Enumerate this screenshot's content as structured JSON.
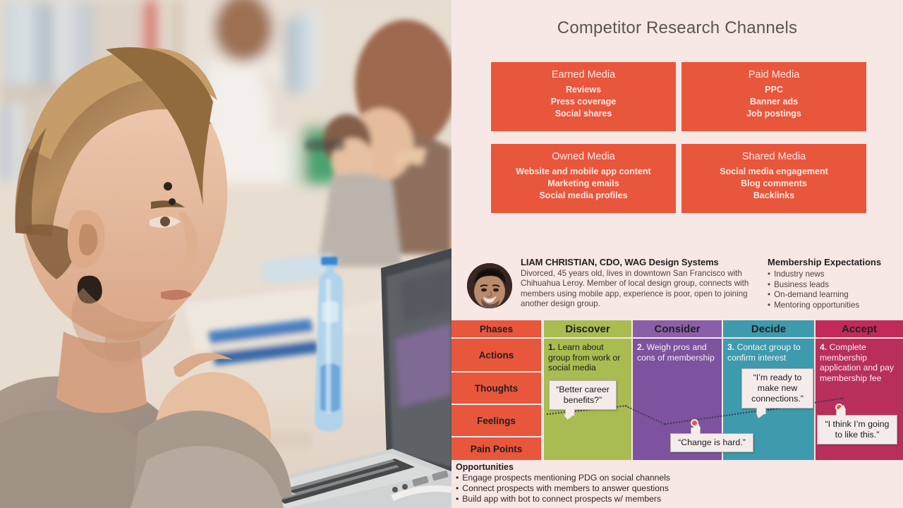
{
  "photo": {
    "alt": "Young man with styled hair studying at a laptop in a library, blurred students and bookshelves behind"
  },
  "slide": {
    "title": "Competitor Research Channels",
    "media_boxes": [
      {
        "title": "Earned Media",
        "items": [
          "Reviews",
          "Press coverage",
          "Social shares"
        ]
      },
      {
        "title": "Paid Media",
        "items": [
          "PPC",
          "Banner ads",
          "Job postings"
        ]
      },
      {
        "title": "Owned Media",
        "items": [
          "Website and mobile app content",
          "Marketing emails",
          "Social media profiles"
        ]
      },
      {
        "title": "Shared Media",
        "items": [
          "Social media engagement",
          "Blog comments",
          "Backlinks"
        ]
      }
    ],
    "persona": {
      "name": "LIAM CHRISTIAN, CDO, WAG Design Systems",
      "description": "Divorced, 45 years old, lives in downtown San Francisco with Chihuahua Leroy. Member of local design group, connects with members using mobile app, experience is poor, open to joining another design group."
    },
    "expectations": {
      "heading": "Membership Expectations",
      "items": [
        "Industry news",
        "Business leads",
        "On-demand learning",
        "Mentoring opportunities"
      ]
    },
    "journey_map": {
      "phase_header": "Phases",
      "row_labels": [
        "Actions",
        "Thoughts",
        "Feelings",
        "Pain Points"
      ],
      "phases": [
        {
          "name": "Discover",
          "color": "#a8bc52",
          "header_color": "#a8bc52",
          "action_num": "1.",
          "action": "Learn about group from work or social media",
          "quote": "“Better career benefits?”"
        },
        {
          "name": "Consider",
          "color": "#7d529e",
          "header_color": "#8a5fa8",
          "action_num": "2.",
          "action": "Weigh pros and cons of membership",
          "quote": "“Change is hard.”"
        },
        {
          "name": "Decide",
          "color": "#3e9aad",
          "header_color": "#3e9aad",
          "action_num": "3.",
          "action": "Contact group to confirm interest",
          "quote": "“I’m ready to make new connections.”"
        },
        {
          "name": "Accept",
          "color": "#b82f5c",
          "header_color": "#c22a58",
          "action_num": "4.",
          "action": "Complete membership application and pay membership fee",
          "quote": "“I think I’m going to like this.”"
        }
      ]
    },
    "opportunities": {
      "heading": "Opportunities",
      "items": [
        "Engage prospects mentioning PDG on social channels",
        "Connect prospects with members to answer questions",
        "Build app with bot to connect prospects w/ members"
      ]
    },
    "colors": {
      "background": "#f7e7e5",
      "accent": "#e8563c",
      "title_text": "#595553",
      "discover": "#a8bc52",
      "consider": "#7d529e",
      "decide": "#3e9aad",
      "accept": "#b82f5c",
      "bubble_bg": "#f4ecea"
    }
  }
}
